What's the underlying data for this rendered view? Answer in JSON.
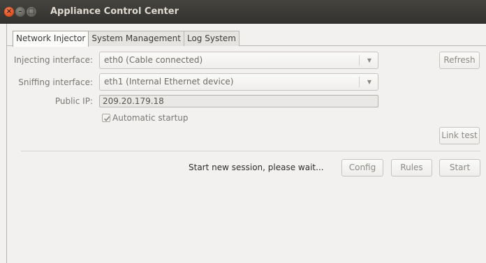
{
  "window": {
    "title": "Appliance Control Center",
    "controls": {
      "close_glyph": "×",
      "minimize_glyph": "–",
      "maximize_glyph": "□"
    }
  },
  "tabs": [
    {
      "label": "Network Injector",
      "active": true
    },
    {
      "label": "System Management",
      "active": false
    },
    {
      "label": "Log System",
      "active": false
    }
  ],
  "form": {
    "injecting_label": "Injecting interface:",
    "injecting_value": "eth0 (Cable connected)",
    "sniffing_label": "Sniffing interface:",
    "sniffing_value": "eth1 (Internal Ethernet device)",
    "public_ip_label": "Public IP:",
    "public_ip_value": "209.20.179.18",
    "autostart_label": "Automatic startup",
    "autostart_checked": true
  },
  "buttons": {
    "refresh": "Refresh",
    "link_test": "Link test",
    "config": "Config",
    "rules": "Rules",
    "start": "Start"
  },
  "status": {
    "text": "Start new session, please wait..."
  },
  "icons": {
    "combo_arrow": "chevron-down-icon",
    "checkbox_mark": "check-icon"
  },
  "colors": {
    "titlebar": "#3a3935",
    "close_button": "#e25320",
    "window_bg": "#f2f1f0"
  }
}
